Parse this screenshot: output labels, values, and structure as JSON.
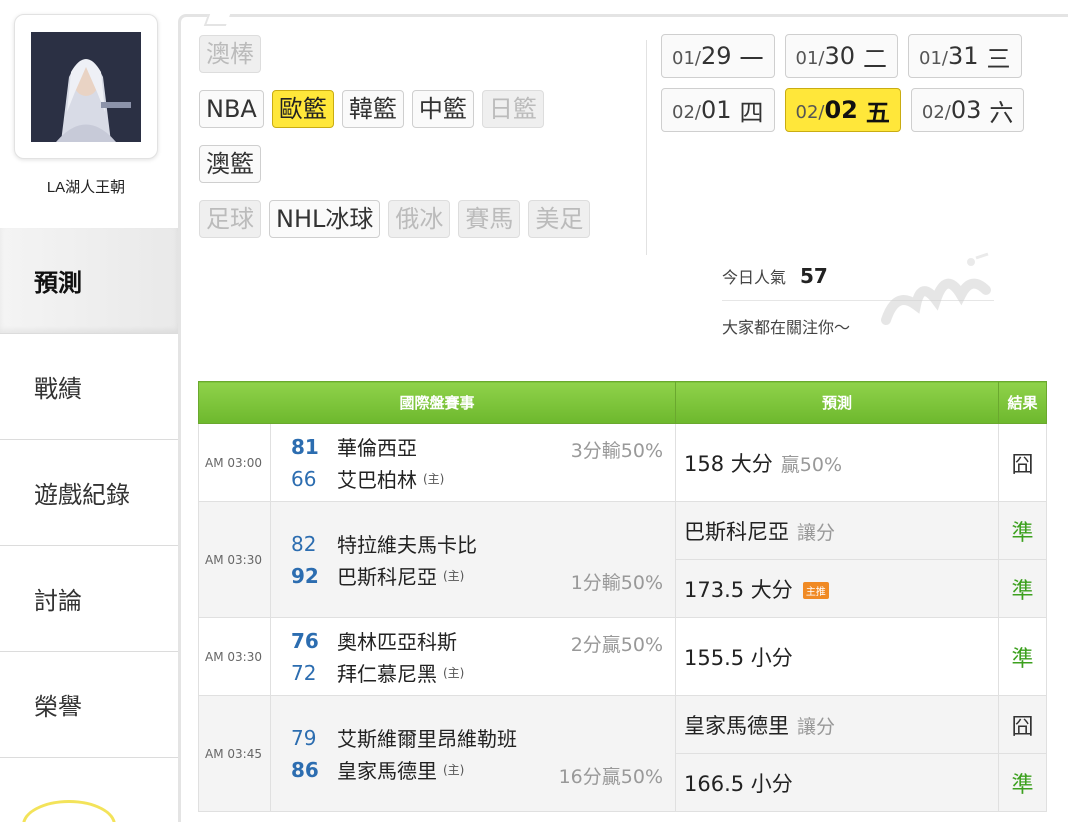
{
  "profile": {
    "name": "LA湖人王朝"
  },
  "nav": [
    {
      "label": "預測",
      "active": true
    },
    {
      "label": "戰績",
      "active": false
    },
    {
      "label": "遊戲紀錄",
      "active": false
    },
    {
      "label": "討論",
      "active": false
    },
    {
      "label": "榮譽",
      "active": false
    }
  ],
  "categories": {
    "row1": [
      {
        "label": "澳棒",
        "state": "disabled"
      }
    ],
    "row2": [
      {
        "label": "NBA",
        "state": "normal"
      },
      {
        "label": "歐籃",
        "state": "selected"
      },
      {
        "label": "韓籃",
        "state": "normal"
      },
      {
        "label": "中籃",
        "state": "normal"
      },
      {
        "label": "日籃",
        "state": "disabled"
      }
    ],
    "row3": [
      {
        "label": "澳籃",
        "state": "normal"
      }
    ],
    "row4": [
      {
        "label": "足球",
        "state": "disabled"
      },
      {
        "label": "NHL冰球",
        "state": "normal"
      },
      {
        "label": "俄冰",
        "state": "disabled"
      },
      {
        "label": "賽馬",
        "state": "disabled"
      },
      {
        "label": "美足",
        "state": "disabled"
      }
    ]
  },
  "dates": {
    "row1": [
      {
        "month": "01/",
        "day": "29",
        "weekday": "一",
        "selected": false
      },
      {
        "month": "01/",
        "day": "30",
        "weekday": "二",
        "selected": false
      },
      {
        "month": "01/",
        "day": "31",
        "weekday": "三",
        "selected": false
      }
    ],
    "row2": [
      {
        "month": "02/",
        "day": "01",
        "weekday": "四",
        "selected": false
      },
      {
        "month": "02/",
        "day": "02",
        "weekday": "五",
        "selected": true
      },
      {
        "month": "02/",
        "day": "03",
        "weekday": "六",
        "selected": false
      }
    ]
  },
  "popularity": {
    "label": "今日人氣",
    "value": "57",
    "subtext": "大家都在關注你～"
  },
  "table": {
    "headers": {
      "event": "國際盤賽事",
      "prediction": "預測",
      "result": "結果"
    },
    "games": [
      {
        "time": "AM 03:00",
        "away": {
          "score": "81",
          "name": "華倫西亞",
          "win": true
        },
        "home": {
          "score": "66",
          "name": "艾巴柏林",
          "win": false
        },
        "home_mark": "(主)",
        "spread": "3分輸50%",
        "spread_row": "away",
        "predictions": [
          {
            "text": "158 大分",
            "extra": "贏50%",
            "tag": "",
            "result": "囧",
            "hit": false
          }
        ]
      },
      {
        "time": "AM 03:30",
        "away": {
          "score": "82",
          "name": "特拉維夫馬卡比",
          "win": false
        },
        "home": {
          "score": "92",
          "name": "巴斯科尼亞",
          "win": true
        },
        "home_mark": "(主)",
        "spread": "1分輸50%",
        "spread_row": "home",
        "predictions": [
          {
            "text": "巴斯科尼亞",
            "extra": "讓分",
            "tag": "",
            "result": "準",
            "hit": true
          },
          {
            "text": "173.5 大分",
            "extra": "",
            "tag": "主推",
            "result": "準",
            "hit": true
          }
        ]
      },
      {
        "time": "AM 03:30",
        "away": {
          "score": "76",
          "name": "奧林匹亞科斯",
          "win": true
        },
        "home": {
          "score": "72",
          "name": "拜仁慕尼黑",
          "win": false
        },
        "home_mark": "(主)",
        "spread": "2分贏50%",
        "spread_row": "away",
        "predictions": [
          {
            "text": "155.5 小分",
            "extra": "",
            "tag": "",
            "result": "準",
            "hit": true
          }
        ]
      },
      {
        "time": "AM 03:45",
        "away": {
          "score": "79",
          "name": "艾斯維爾里昂維勒班",
          "win": false
        },
        "home": {
          "score": "86",
          "name": "皇家馬德里",
          "win": true
        },
        "home_mark": "(主)",
        "spread": "16分贏50%",
        "spread_row": "home",
        "predictions": [
          {
            "text": "皇家馬德里",
            "extra": "讓分",
            "tag": "",
            "result": "囧",
            "hit": false
          },
          {
            "text": "166.5 小分",
            "extra": "",
            "tag": "",
            "result": "準",
            "hit": true
          }
        ]
      }
    ]
  }
}
